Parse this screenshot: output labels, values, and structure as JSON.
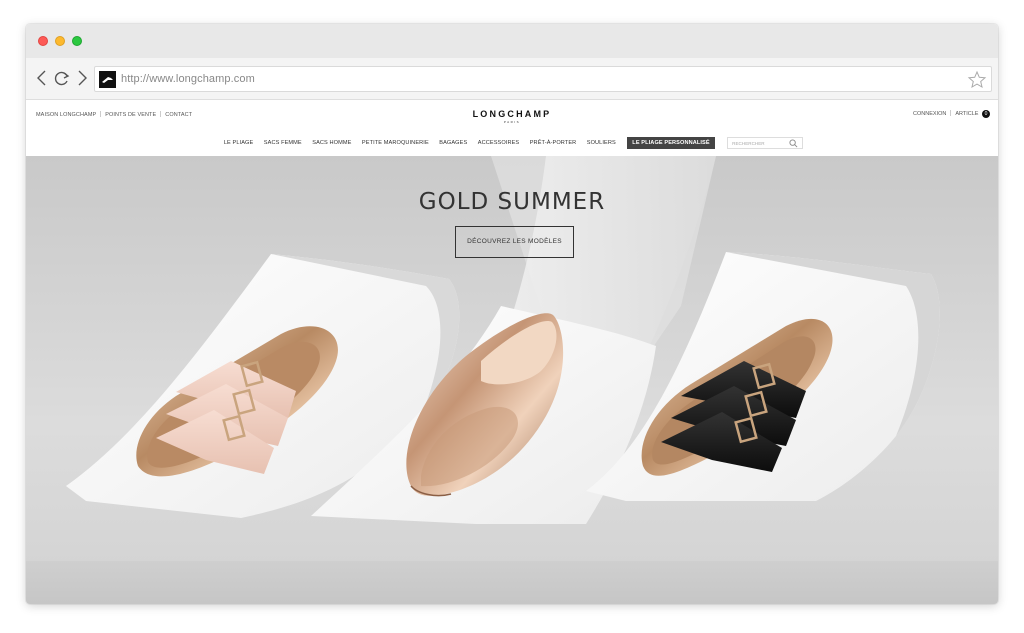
{
  "browser": {
    "url": "http://www.longchamp.com"
  },
  "site": {
    "util_links": [
      "MAISON LONGCHAMP",
      "POINTS DE VENTE",
      "CONTACT"
    ],
    "brand": {
      "name": "LONGCHAMP",
      "sub": "PARIS"
    },
    "account": {
      "login": "CONNEXION",
      "cart_label": "ARTICLE",
      "cart_count": "0"
    },
    "menu": [
      "LE PLIAGE",
      "SACS FEMME",
      "SACS HOMME",
      "PETITE MAROQUINERIE",
      "BAGAGES",
      "ACCESSOIRES",
      "PRÊT-À-PORTER",
      "SOULIERS"
    ],
    "menu_highlight": "LE PLIAGE PERSONNALISÉ",
    "search_placeholder": "RECHERCHER"
  },
  "hero": {
    "title": "GOLD SUMMER",
    "cta": "DÉCOUVREZ LES MODÈLES",
    "products": [
      "pink-buckle-sandal",
      "gold-loafer",
      "black-buckle-sandal"
    ]
  }
}
